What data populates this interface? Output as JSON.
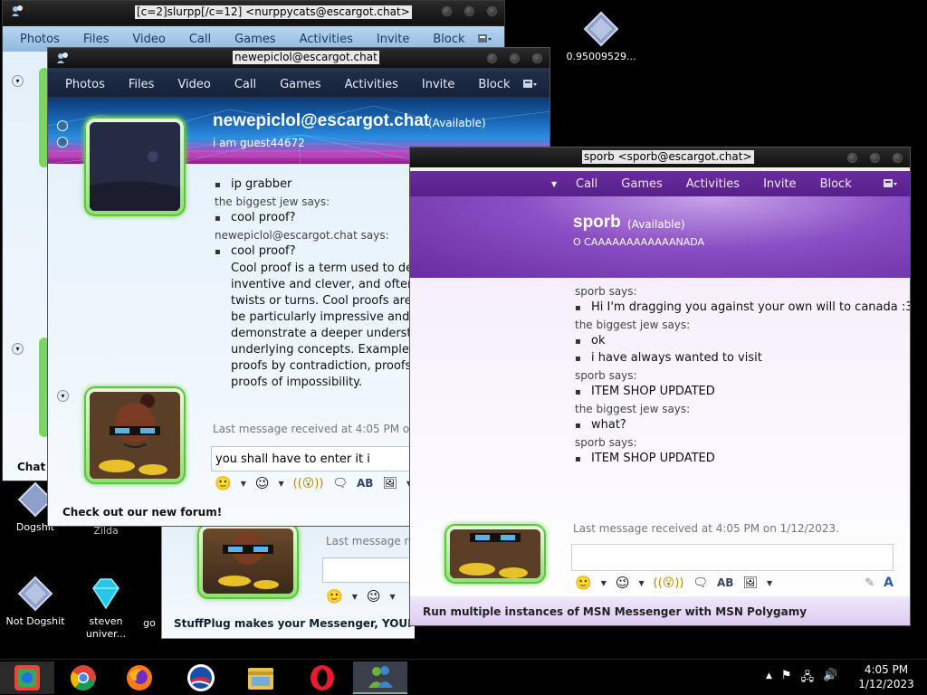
{
  "desktop": {
    "icons": [
      {
        "label": "0.95009529..."
      },
      {
        "label": "Dogshit"
      },
      {
        "label": "Legend of Zilda"
      },
      {
        "label": "go"
      },
      {
        "label": "Not Dogshit"
      },
      {
        "label": "steven univer..."
      },
      {
        "label": "go"
      }
    ]
  },
  "back_window": {
    "title": "[c=2]slurpp[/c=12] <nurppycats@escargot.chat>",
    "menu": [
      "Photos",
      "Files",
      "Video",
      "Call",
      "Games",
      "Activities",
      "Invite",
      "Block"
    ],
    "chat_label": "Chat",
    "last_message": "Last message re",
    "footer": "StuffPlug makes your Messenger, YOUR M"
  },
  "main_window": {
    "title": "newepiclol@escargot.chat",
    "menu": [
      "Photos",
      "Files",
      "Video",
      "Call",
      "Games",
      "Activities",
      "Invite",
      "Block"
    ],
    "contact_name": "newepiclol@escargot.chat",
    "status": "(Available)",
    "personal_message": "i am guest44672",
    "messages": [
      {
        "type": "msg",
        "text": "ip grabber"
      },
      {
        "type": "sender",
        "text": "the biggest jew says:"
      },
      {
        "type": "msg",
        "text": "cool proof?"
      },
      {
        "type": "sender",
        "text": "newepiclol@escargot.chat says:"
      },
      {
        "type": "msg",
        "text": "cool proof?"
      }
    ],
    "long_message": [
      "Cool proof is a term used to describe proofs that are",
      "inventive and clever, and often involve unexpected",
      "twists or turns. Cool proofs are often considered to",
      "be particularly impressive and are used to",
      "demonstrate a deeper understanding of the",
      "underlying concepts. Examples of cool proofs include",
      "proofs by contradiction, proofs by induction, and",
      "proofs of impossibility."
    ],
    "last_message": "Last message received at 4:05 PM on 1/12/2023.",
    "input_value": "you shall have to enter it i",
    "footer": "Check out our new forum!"
  },
  "right_window": {
    "title": "sporb <sporb@escargot.chat>",
    "menu": [
      "Call",
      "Games",
      "Activities",
      "Invite",
      "Block"
    ],
    "contact_name": "sporb",
    "status": "(Available)",
    "personal_message": "O CAAAAAAAAAAAANADA",
    "messages": [
      {
        "type": "sender",
        "text": "sporb says:"
      },
      {
        "type": "msg",
        "text": "Hi I'm dragging you against your own will to canada :3"
      },
      {
        "type": "sender",
        "text": "the biggest jew says:"
      },
      {
        "type": "msg",
        "text": "ok"
      },
      {
        "type": "msg",
        "text": "i have always wanted to visit"
      },
      {
        "type": "sender",
        "text": "sporb says:"
      },
      {
        "type": "msg",
        "text": "ITEM SHOP UPDATED"
      },
      {
        "type": "sender",
        "text": "the biggest jew says:"
      },
      {
        "type": "msg",
        "text": "what?"
      },
      {
        "type": "sender",
        "text": "sporb says:"
      },
      {
        "type": "msg",
        "text": "ITEM SHOP UPDATED"
      }
    ],
    "last_message": "Last message received at 4:05 PM on 1/12/2023.",
    "footer": "Run multiple instances of MSN Messenger with MSN Polygamy"
  },
  "taskbar": {
    "time": "4:05 PM",
    "date": "1/12/2023"
  }
}
